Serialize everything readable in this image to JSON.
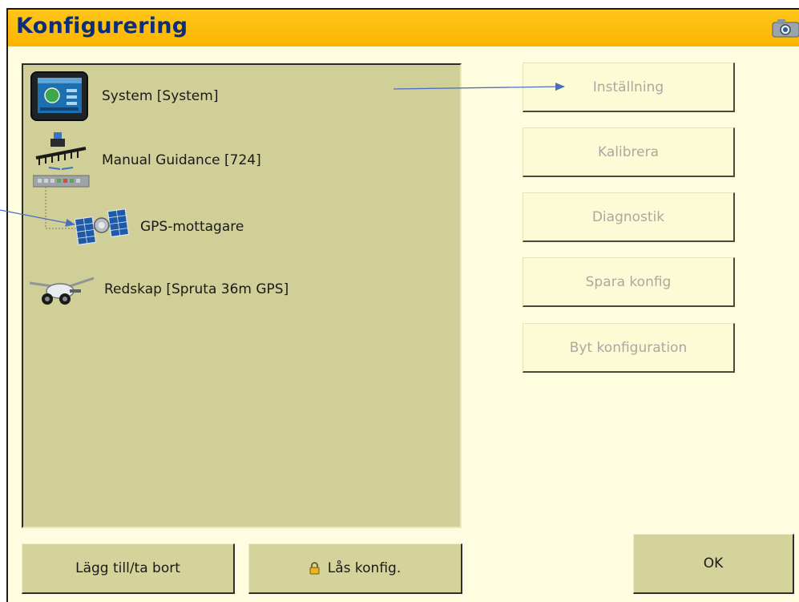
{
  "window": {
    "title": "Konfigurering"
  },
  "icons": {
    "camera": "camera-icon",
    "lock": "lock-icon"
  },
  "colors": {
    "title_bar": "#fdb400",
    "title_text": "#0c2d7a",
    "panel": "#cfcf97",
    "background": "#fefde0",
    "callout_arrow": "#4a6fbf"
  },
  "tree": {
    "items": [
      {
        "label": "System [System]",
        "icon": "display-terminal-icon"
      },
      {
        "label": "Manual Guidance [724]",
        "icon": "lightbar-guidance-icon"
      },
      {
        "label": "GPS-mottagare",
        "icon": "satellite-icon"
      },
      {
        "label": "Redskap [Spruta 36m GPS]",
        "icon": "sprayer-icon"
      }
    ]
  },
  "actions": {
    "settings": "Inställning",
    "calibrate": "Kalibrera",
    "diagnostics": "Diagnostik",
    "save_config": "Spara konfig",
    "change_config": "Byt konfiguration"
  },
  "footer": {
    "add_remove": "Lägg till/ta bort",
    "lock_config": "Lås konfig.",
    "ok": "OK"
  }
}
